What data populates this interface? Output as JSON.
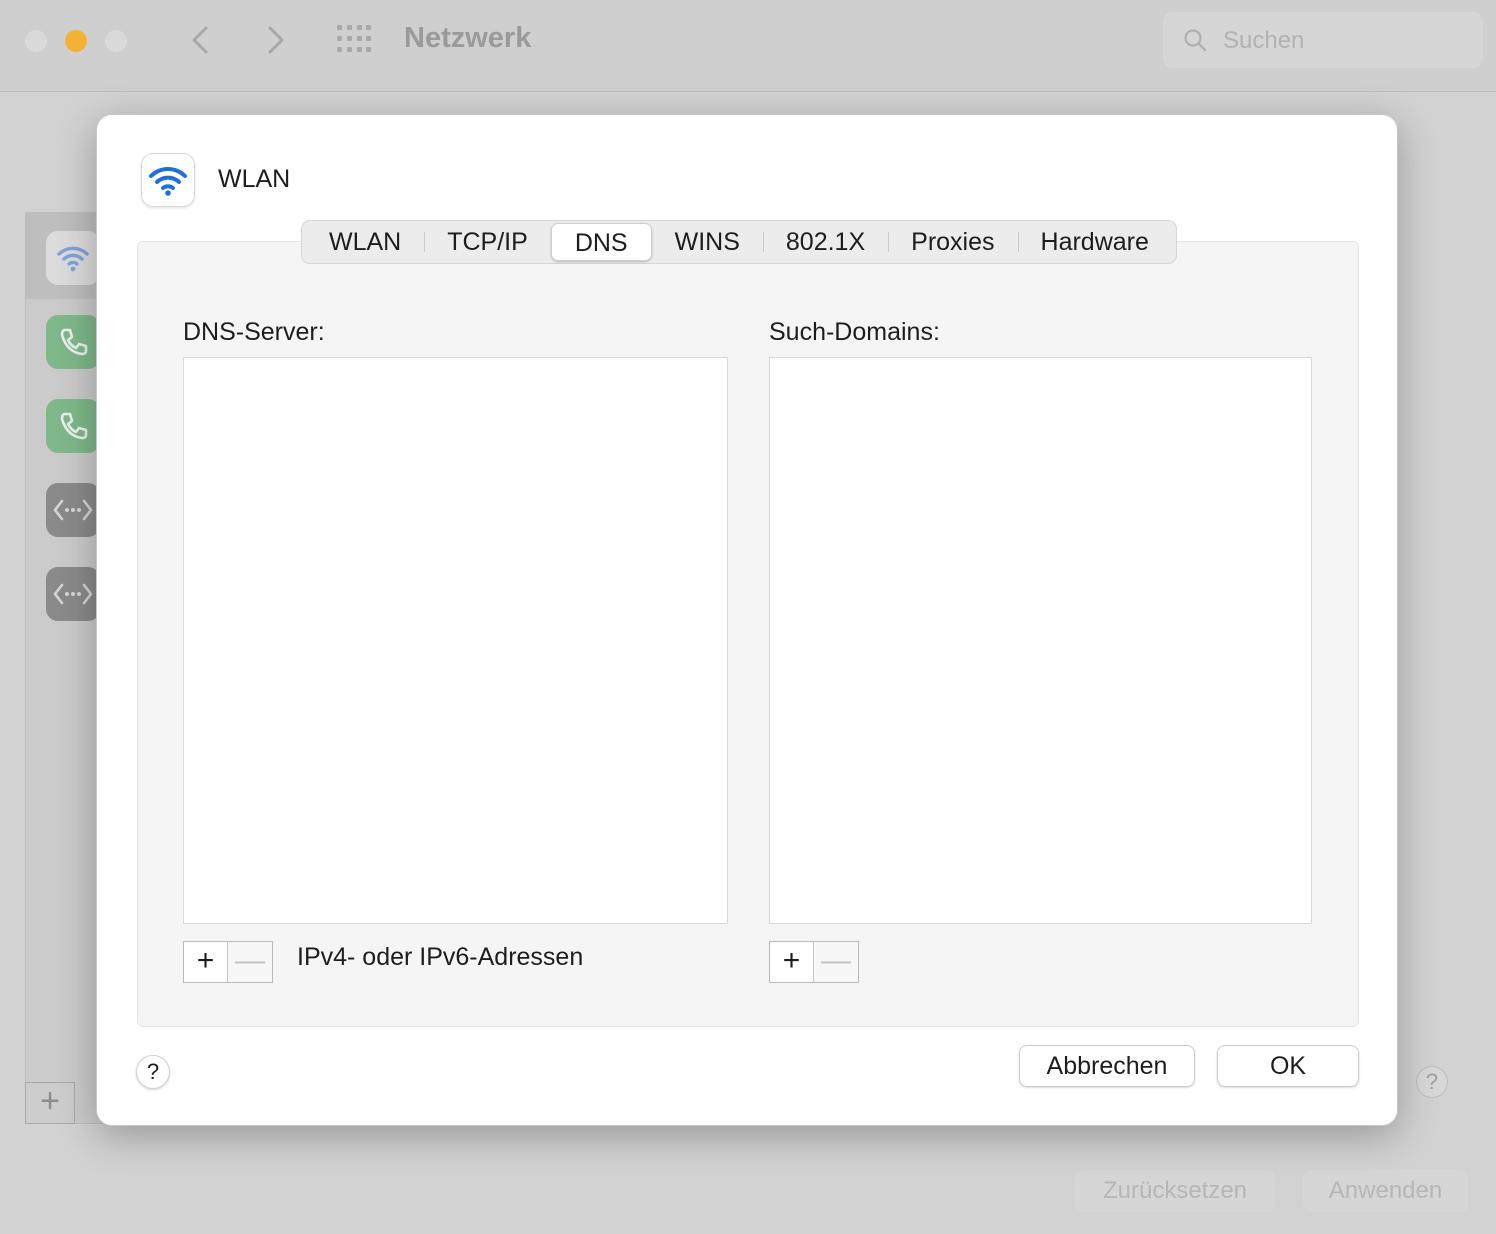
{
  "window": {
    "title": "Netzwerk",
    "search_placeholder": "Suchen"
  },
  "background": {
    "add_symbol": "+",
    "help_symbol": "?",
    "reset_label": "Zurücksetzen",
    "apply_label": "Anwenden"
  },
  "sheet": {
    "service_name": "WLAN",
    "tabs": [
      {
        "label": "WLAN",
        "active": false
      },
      {
        "label": "TCP/IP",
        "active": false
      },
      {
        "label": "DNS",
        "active": true
      },
      {
        "label": "WINS",
        "active": false
      },
      {
        "label": "802.1X",
        "active": false
      },
      {
        "label": "Proxies",
        "active": false
      },
      {
        "label": "Hardware",
        "active": false
      }
    ],
    "dns_servers": {
      "label": "DNS-Server:",
      "entries": [],
      "hint": "IPv4- oder IPv6-Adressen"
    },
    "search_domains": {
      "label": "Such-Domains:",
      "entries": []
    },
    "plus_symbol": "+",
    "minus_symbol": "—",
    "help_symbol": "?",
    "cancel_label": "Abbrechen",
    "ok_label": "OK"
  },
  "colors": {
    "accent": "#1f6fe0",
    "minimize": "#f5b133",
    "phone_service": "#7fb88a",
    "ethernet_service": "#8a8a8a"
  },
  "icons": {
    "sheet_icon": "wifi-icon",
    "search": "search-icon",
    "sidebar": [
      "wifi-icon",
      "phone-icon",
      "phone-icon",
      "ethernet-icon",
      "ethernet-icon"
    ]
  }
}
